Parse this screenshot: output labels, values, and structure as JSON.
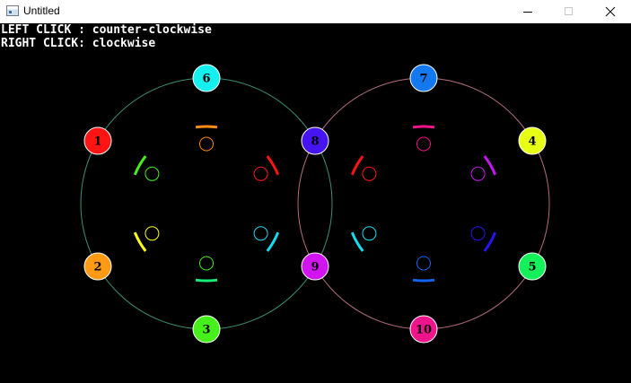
{
  "window": {
    "title": "Untitled"
  },
  "instructions": {
    "left": "LEFT CLICK : counter-clockwise",
    "right": "RIGHT CLICK: clockwise"
  },
  "rings": {
    "left_ring_color": "#3c8f7a",
    "right_ring_color": "#b46e7e"
  },
  "nodes": [
    {
      "label": "1",
      "color": "#ff1414"
    },
    {
      "label": "2",
      "color": "#ff9a14"
    },
    {
      "label": "3",
      "color": "#46f01a"
    },
    {
      "label": "4",
      "color": "#e6ff14"
    },
    {
      "label": "5",
      "color": "#14f05a"
    },
    {
      "label": "6",
      "color": "#14f0f0"
    },
    {
      "label": "7",
      "color": "#1478f0"
    },
    {
      "label": "8",
      "color": "#4614f0"
    },
    {
      "label": "9",
      "color": "#d214f0"
    },
    {
      "label": "10",
      "color": "#f0148c"
    }
  ],
  "left_slots": [
    {
      "color": "#ff8c14"
    },
    {
      "color": "#ff1414"
    },
    {
      "color": "#14dcf0"
    },
    {
      "color": "#14f078"
    },
    {
      "color": "#ffff14"
    },
    {
      "color": "#46f01a"
    }
  ],
  "right_slots": [
    {
      "color": "#f0148c"
    },
    {
      "color": "#c814f0"
    },
    {
      "color": "#2814f0"
    },
    {
      "color": "#1464f0"
    },
    {
      "color": "#14dcf0"
    },
    {
      "color": "#ff1414"
    }
  ],
  "left_inner_circles": [
    "#ff8c14",
    "#ff1414",
    "#14dcf0",
    "#46f01a",
    "#ffff14",
    "#46f01a"
  ],
  "right_inner_circles": [
    "#f0148c",
    "#c814f0",
    "#2814f0",
    "#1464f0",
    "#14dcf0",
    "#ff1414"
  ]
}
